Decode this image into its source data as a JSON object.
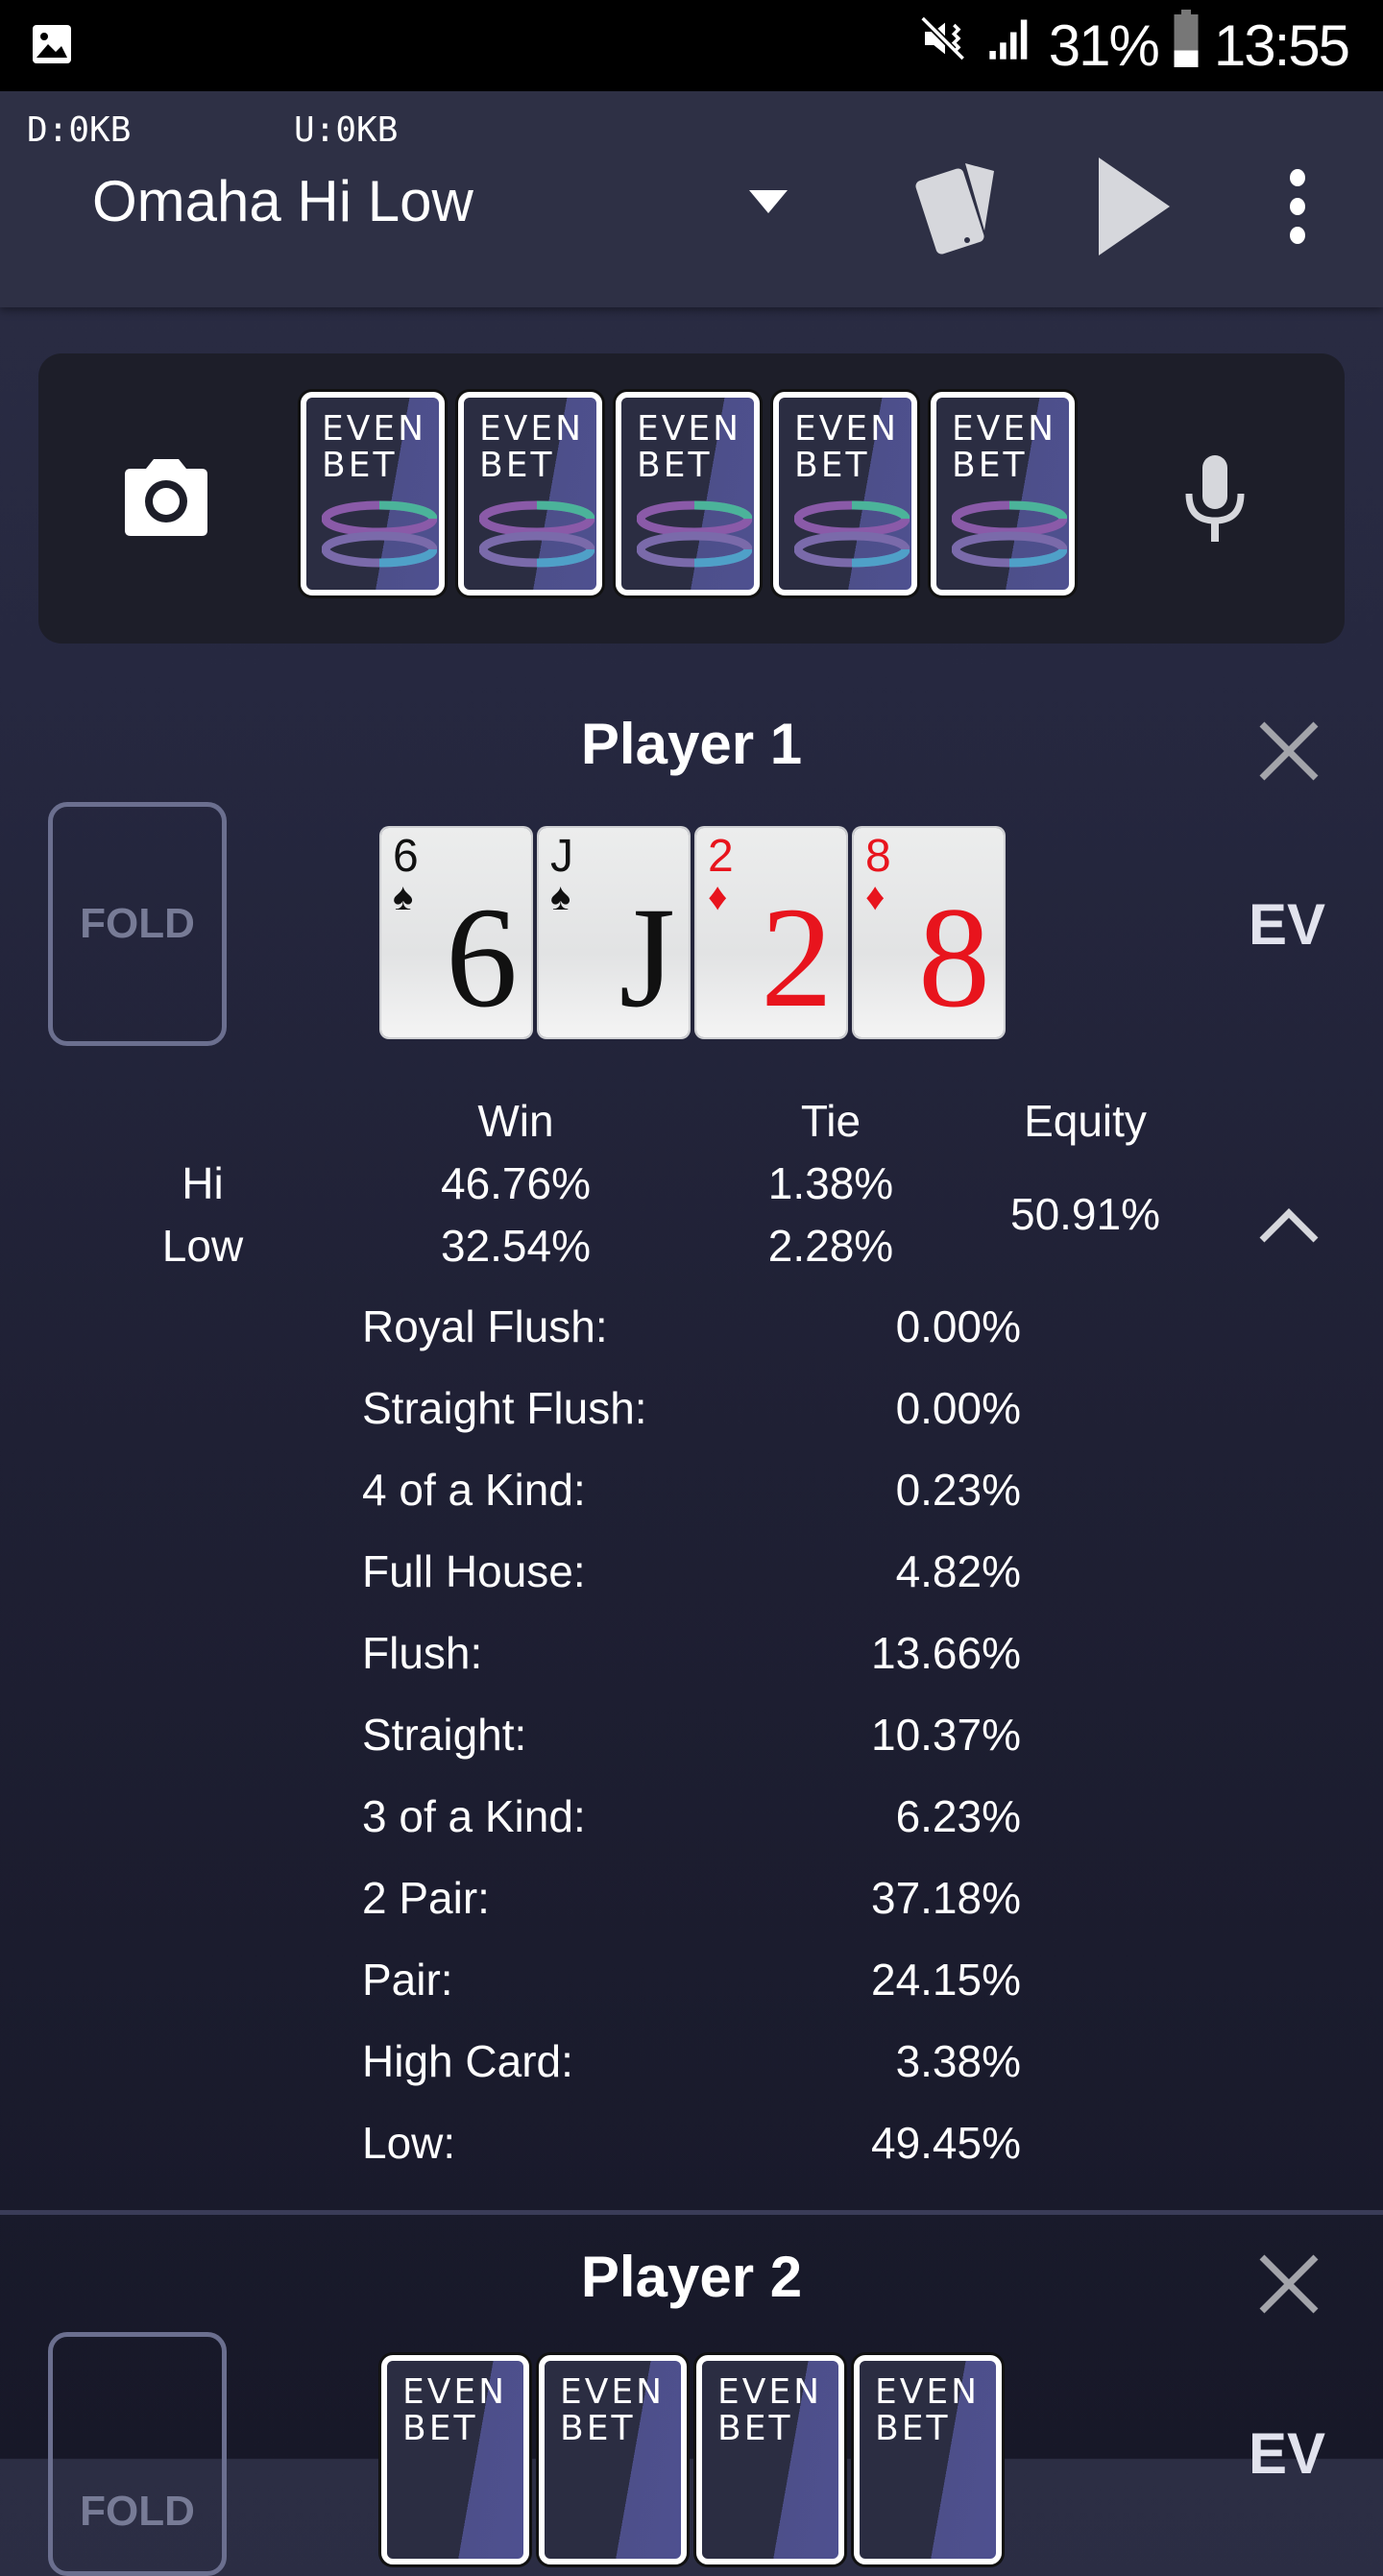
{
  "status_bar": {
    "notification_icon": "image-icon",
    "icons": [
      "mute-vibrate-icon",
      "signal-icon",
      "battery-icon"
    ],
    "battery": "31%",
    "time": "13:55"
  },
  "app_bar": {
    "download": "D:0KB",
    "upload": "U:0KB",
    "game_type": "Omaha Hi Low",
    "actions": [
      "dropdown-icon",
      "random-cards-icon",
      "play-icon",
      "more-vert-icon"
    ]
  },
  "board": {
    "camera_icon": "camera-icon",
    "mic_icon": "mic-icon",
    "cards": [
      {
        "back": "EVEN BET",
        "logo_top": "EVEN",
        "logo_bottom": "BET"
      },
      {
        "back": "EVEN BET",
        "logo_top": "EVEN",
        "logo_bottom": "BET"
      },
      {
        "back": "EVEN BET",
        "logo_top": "EVEN",
        "logo_bottom": "BET"
      },
      {
        "back": "EVEN BET",
        "logo_top": "EVEN",
        "logo_bottom": "BET"
      },
      {
        "back": "EVEN BET",
        "logo_top": "EVEN",
        "logo_bottom": "BET"
      }
    ]
  },
  "players": [
    {
      "name": "Player 1",
      "fold_label": "FOLD",
      "ev_label": "EV",
      "cards": [
        {
          "rank": "6",
          "suit": "♠",
          "color": "black"
        },
        {
          "rank": "J",
          "suit": "♠",
          "color": "black"
        },
        {
          "rank": "2",
          "suit": "♦",
          "color": "red"
        },
        {
          "rank": "8",
          "suit": "♦",
          "color": "red"
        }
      ],
      "stats": {
        "headers": {
          "win": "Win",
          "tie": "Tie",
          "equity": "Equity"
        },
        "rows": [
          {
            "label": "Hi",
            "win": "46.76%",
            "tie": "1.38%"
          },
          {
            "label": "Low",
            "win": "32.54%",
            "tie": "2.28%"
          }
        ],
        "equity": "50.91%"
      },
      "collapse_icon": "chevron-up-icon",
      "hands": [
        {
          "label": "Royal Flush:",
          "value": "0.00%"
        },
        {
          "label": "Straight Flush:",
          "value": "0.00%"
        },
        {
          "label": "4 of a Kind:",
          "value": "0.23%"
        },
        {
          "label": "Full House:",
          "value": "4.82%"
        },
        {
          "label": "Flush:",
          "value": "13.66%"
        },
        {
          "label": "Straight:",
          "value": "10.37%"
        },
        {
          "label": "3 of a Kind:",
          "value": "6.23%"
        },
        {
          "label": "2 Pair:",
          "value": "37.18%"
        },
        {
          "label": "Pair:",
          "value": "24.15%"
        },
        {
          "label": "High Card:",
          "value": "3.38%"
        },
        {
          "label": "Low:",
          "value": "49.45%"
        }
      ]
    },
    {
      "name": "Player 2",
      "fold_label": "FOLD",
      "ev_label": "EV",
      "cards": [
        {
          "back": "EVEN BET",
          "logo_top": "EVEN",
          "logo_bottom": "BET"
        },
        {
          "back": "EVEN BET",
          "logo_top": "EVEN",
          "logo_bottom": "BET"
        },
        {
          "back": "EVEN BET",
          "logo_top": "EVEN",
          "logo_bottom": "BET"
        },
        {
          "back": "EVEN BET",
          "logo_top": "EVEN",
          "logo_bottom": "BET"
        }
      ]
    }
  ]
}
